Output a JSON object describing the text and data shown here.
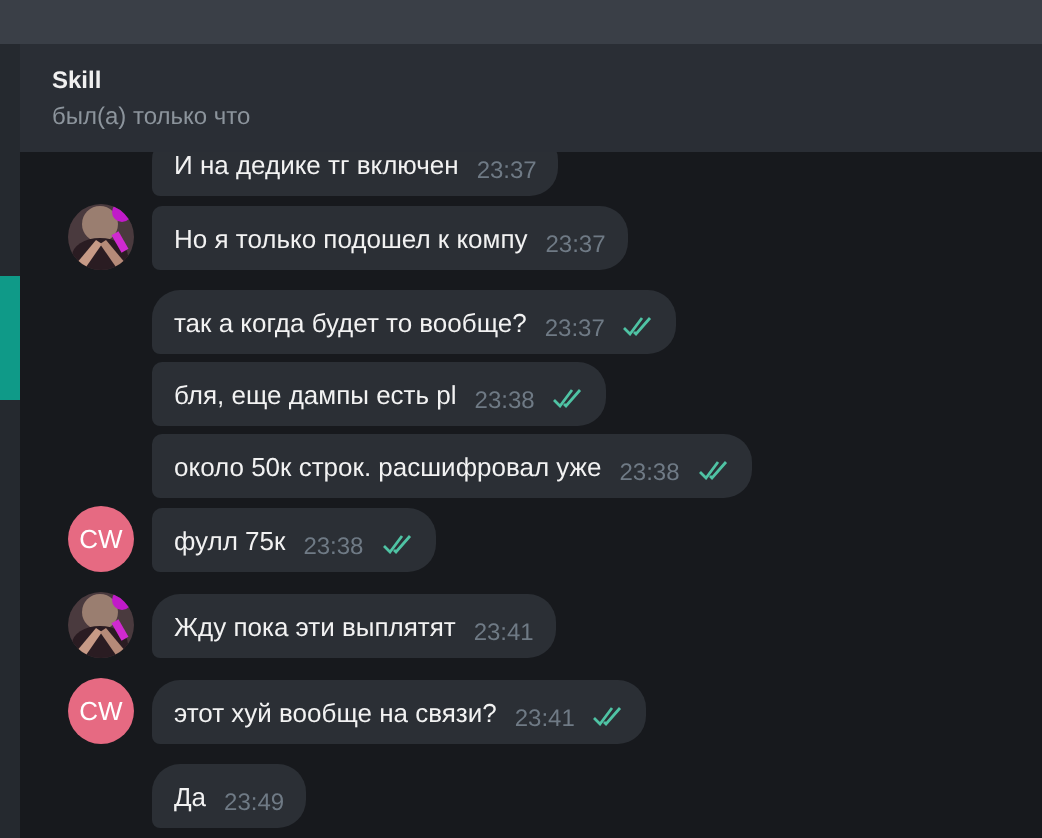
{
  "chat": {
    "title": "Skill",
    "status": "был(а) только что"
  },
  "messages": [
    {
      "text": "И на дедике тг включен",
      "time": "23:37",
      "kind": "plain",
      "read": false,
      "group_start": true
    },
    {
      "text": "Но я только подошел к компу",
      "time": "23:37",
      "read": false,
      "group_start": false
    },
    {
      "text": "так а когда будет то вообще?",
      "time": "23:37",
      "kind": "plain",
      "read": true,
      "group_start": true
    },
    {
      "text": "бля, еще дампы есть pl",
      "time": "23:38",
      "kind": "plain",
      "read": true,
      "group_start": false
    },
    {
      "text": "около 50к строк. расшифровал уже",
      "time": "23:38",
      "kind": "plain",
      "read": true,
      "group_start": false
    },
    {
      "text": "фулл 75к",
      "time": "23:38",
      "kind": "initials",
      "initials": "CW",
      "read": true,
      "group_start": false
    },
    {
      "text": "Жду пока эти выплятят",
      "time": "23:41",
      "read": false,
      "group_start": true
    },
    {
      "text": "этот хуй вообще на связи?",
      "time": "23:41",
      "kind": "initials",
      "initials": "CW",
      "read": true,
      "group_start": true
    },
    {
      "text": "Да",
      "time": "23:49",
      "kind": "plain",
      "read": false,
      "group_start": true
    }
  ]
}
